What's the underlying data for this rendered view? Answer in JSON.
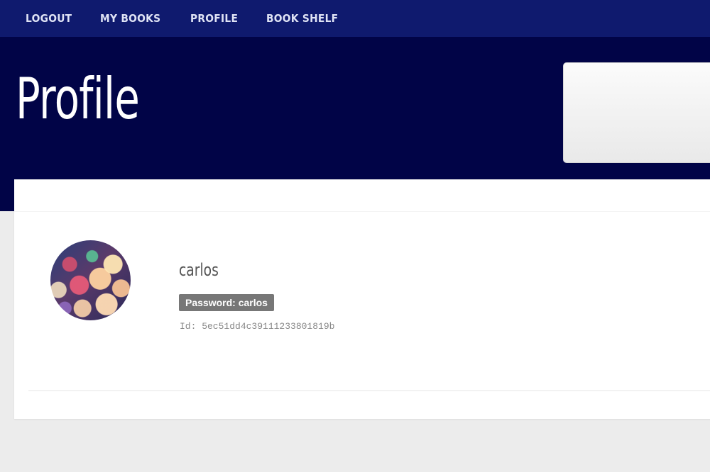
{
  "nav": {
    "items": [
      {
        "label": "LOGOUT"
      },
      {
        "label": "MY BOOKS"
      },
      {
        "label": "PROFILE"
      },
      {
        "label": "BOOK SHELF"
      }
    ]
  },
  "hero": {
    "title": "Profile"
  },
  "profile": {
    "username": "carlos",
    "password_badge": "Password: carlos",
    "id_text": "Id: 5ec51dd4c39111233801819b"
  },
  "colors": {
    "nav_bg": "#0f1a6e",
    "hero_bg": "#010447",
    "page_bg": "#ececec",
    "badge_bg": "#777777"
  },
  "icons": {
    "avatar": "bokeh-avatar-image"
  }
}
